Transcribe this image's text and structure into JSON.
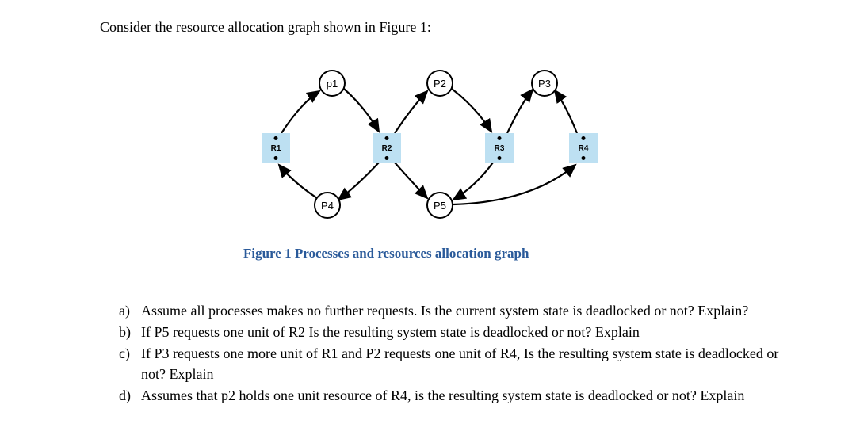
{
  "intro": "Consider the resource allocation graph shown in Figure 1:",
  "caption": "Figure 1 Processes and resources allocation graph",
  "processes": {
    "p1": "p1",
    "p2": "P2",
    "p3": "P3",
    "p4": "P4",
    "p5": "P5"
  },
  "resources": {
    "r1": "R1",
    "r2": "R2",
    "r3": "R3",
    "r4": "R4"
  },
  "questions": [
    {
      "label": "a)",
      "text": "Assume all processes makes no further requests. Is the current system state is deadlocked or not? Explain?"
    },
    {
      "label": "b)",
      "text": "If P5 requests one unit of R2 Is the resulting system state is deadlocked or not? Explain"
    },
    {
      "label": "c)",
      "text": "If P3 requests one more unit of R1 and P2 requests one unit of R4, Is the resulting system state is deadlocked or not? Explain"
    },
    {
      "label": "d)",
      "text": "Assumes that p2 holds one unit resource of R4, is the resulting system state is deadlocked or not? Explain"
    }
  ]
}
